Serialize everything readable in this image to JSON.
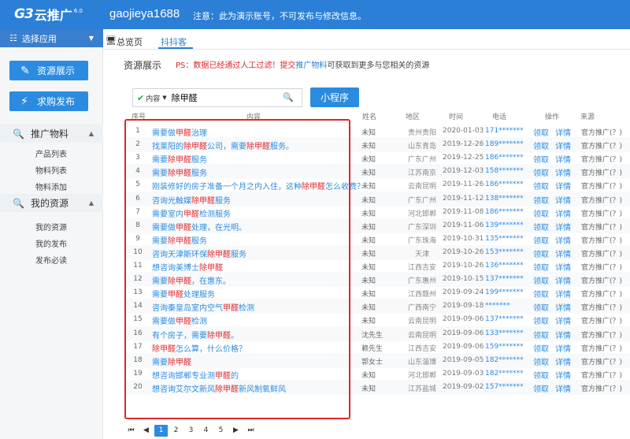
{
  "header": {
    "logo_text": "G3",
    "logo_cn": "云推广",
    "version": "6.0",
    "username": "gaojieya1688",
    "notice": "注意：此为演示账号，不可发布与修改信息。"
  },
  "sidebar": {
    "select_app": "选择应用",
    "btn_resource": "资源展示",
    "btn_buy": "求购发布",
    "section_promo": "推广物料",
    "promo_items": [
      "产品列表",
      "物料列表",
      "物料添加"
    ],
    "section_mine": "我的资源",
    "mine_items": [
      "我的资源",
      "我的发布",
      "发布必读"
    ]
  },
  "tabs": [
    "总览页",
    "抖抖客"
  ],
  "main": {
    "title": "资源展示",
    "ps_prefix": "PS：数据已经通过人工过滤！提交",
    "ps_link": "推广物料",
    "ps_suffix": "可获取到更多与您相关的资源",
    "search_dropdown": "内容",
    "search_value": "除甲醛",
    "mini_program_button": "小程序"
  },
  "table": {
    "headers": [
      "序号",
      "内容",
      "姓名",
      "地区",
      "时间",
      "电话",
      "操作",
      "来源"
    ],
    "take_label": "领取",
    "detail_label": "详情",
    "rows": [
      {
        "idx": "1",
        "parts": [
          "需要做",
          "甲醛",
          "治理"
        ],
        "name": "未知",
        "area": "贵州贵阳",
        "time": "2020-01-03",
        "phone": "171*******",
        "source": "官方推广(？)"
      },
      {
        "idx": "2",
        "parts": [
          "找莱阳的",
          "除甲醛",
          "公司，需要",
          "除甲醛",
          "服务。"
        ],
        "name": "未知",
        "area": "山东青岛",
        "time": "2019-12-26",
        "phone": "189*******",
        "source": "官方推广(？)"
      },
      {
        "idx": "3",
        "parts": [
          "需要",
          "除甲醛",
          "服务"
        ],
        "name": "未知",
        "area": "广东广州",
        "time": "2019-12-25",
        "phone": "186*******",
        "source": "官方推广(？)"
      },
      {
        "idx": "4",
        "parts": [
          "需要",
          "除甲醛",
          "服务"
        ],
        "name": "未知",
        "area": "江苏南京",
        "time": "2019-12-03",
        "phone": "158*******",
        "source": "官方推广(？)"
      },
      {
        "idx": "5",
        "parts": [
          "刚装修好的房子准备一个月之内入住，这种",
          "除甲醛",
          "怎么收费？"
        ],
        "name": "未知",
        "area": "云南昆明",
        "time": "2019-11-26",
        "phone": "186*******",
        "source": "官方推广(？)"
      },
      {
        "idx": "6",
        "parts": [
          "咨询光触媒",
          "除甲醛",
          "服务"
        ],
        "name": "未知",
        "area": "广东广州",
        "time": "2019-11-12",
        "phone": "138*******",
        "source": "官方推广(？)"
      },
      {
        "idx": "7",
        "parts": [
          "需要室内",
          "甲醛",
          "检测服务"
        ],
        "name": "未知",
        "area": "河北邯郸",
        "time": "2019-11-08",
        "phone": "186*******",
        "source": "官方推广(？)"
      },
      {
        "idx": "8",
        "parts": [
          "需要做",
          "甲醛",
          "处理，在光明。"
        ],
        "name": "未知",
        "area": "广东深圳",
        "time": "2019-11-06",
        "phone": "139*******",
        "source": "官方推广(？)"
      },
      {
        "idx": "9",
        "parts": [
          "需要",
          "除甲醛",
          "服务"
        ],
        "name": "未知",
        "area": "广东珠海",
        "time": "2019-10-31",
        "phone": "135*******",
        "source": "官方推广(？)"
      },
      {
        "idx": "10",
        "parts": [
          "咨询天津斯环保",
          "除甲醛",
          "服务"
        ],
        "name": "未知",
        "area": "天津",
        "time": "2019-10-26",
        "phone": "153*******",
        "source": "官方推广(？)"
      },
      {
        "idx": "11",
        "parts": [
          "想咨询美博士",
          "除甲醛",
          ""
        ],
        "name": "未知",
        "area": "江西吉安",
        "time": "2019-10-26",
        "phone": "136*******",
        "source": "官方推广(？)"
      },
      {
        "idx": "12",
        "parts": [
          "需要",
          "除甲醛",
          "，在惠东。"
        ],
        "name": "未知",
        "area": "广东惠州",
        "time": "2019-10-15",
        "phone": "137*******",
        "source": "官方推广(？)"
      },
      {
        "idx": "13",
        "parts": [
          "需要",
          "甲醛",
          "处理服务"
        ],
        "name": "未知",
        "area": "江西赣州",
        "time": "2019-09-24",
        "phone": "199*******",
        "source": "官方推广(？)"
      },
      {
        "idx": "14",
        "parts": [
          "咨询秦皇岛室内空气",
          "甲醛",
          "检测"
        ],
        "name": "未知",
        "area": "广西南宁",
        "time": "2019-09-18",
        "phone": "*******",
        "source": "官方推广(？)"
      },
      {
        "idx": "15",
        "parts": [
          "需要做",
          "甲醛",
          "检测"
        ],
        "name": "未知",
        "area": "云南昆明",
        "time": "2019-09-06",
        "phone": "137*******",
        "source": "官方推广(？)"
      },
      {
        "idx": "16",
        "parts": [
          "有个房子，需要",
          "除甲醛",
          "。"
        ],
        "name": "沈先生",
        "area": "云南昆明",
        "time": "2019-09-06",
        "phone": "133*******",
        "source": "官方推广(？)"
      },
      {
        "idx": "17",
        "parts": [
          "",
          "除甲醛",
          "怎么算，什么价格？"
        ],
        "name": "赖先生",
        "area": "江西吉安",
        "time": "2019-09-06",
        "phone": "159*******",
        "source": "官方推广(？)"
      },
      {
        "idx": "18",
        "parts": [
          "需要",
          "除甲醛",
          ""
        ],
        "name": "郭女士",
        "area": "山东淄博",
        "time": "2019-09-05",
        "phone": "182*******",
        "source": "官方推广(？)"
      },
      {
        "idx": "19",
        "parts": [
          "想咨询邯郸专业测",
          "甲醛",
          "的"
        ],
        "name": "未知",
        "area": "河北邯郸",
        "time": "2019-09-03",
        "phone": "182*******",
        "source": "官方推广(？)"
      },
      {
        "idx": "20",
        "parts": [
          "想咨询艾尔文新风",
          "除甲醛",
          "新风制氧鲜风"
        ],
        "name": "未知",
        "area": "江苏盐城",
        "time": "2019-09-02",
        "phone": "157*******",
        "source": "官方推广(？)"
      }
    ]
  },
  "pager": {
    "first": "⏮",
    "prev": "◀",
    "pages": [
      "1",
      "2",
      "3",
      "4",
      "5"
    ],
    "next": "▶",
    "last": "⏭"
  },
  "colors": {
    "primary": "#2b7fd6",
    "highlight": "#e0262b"
  }
}
